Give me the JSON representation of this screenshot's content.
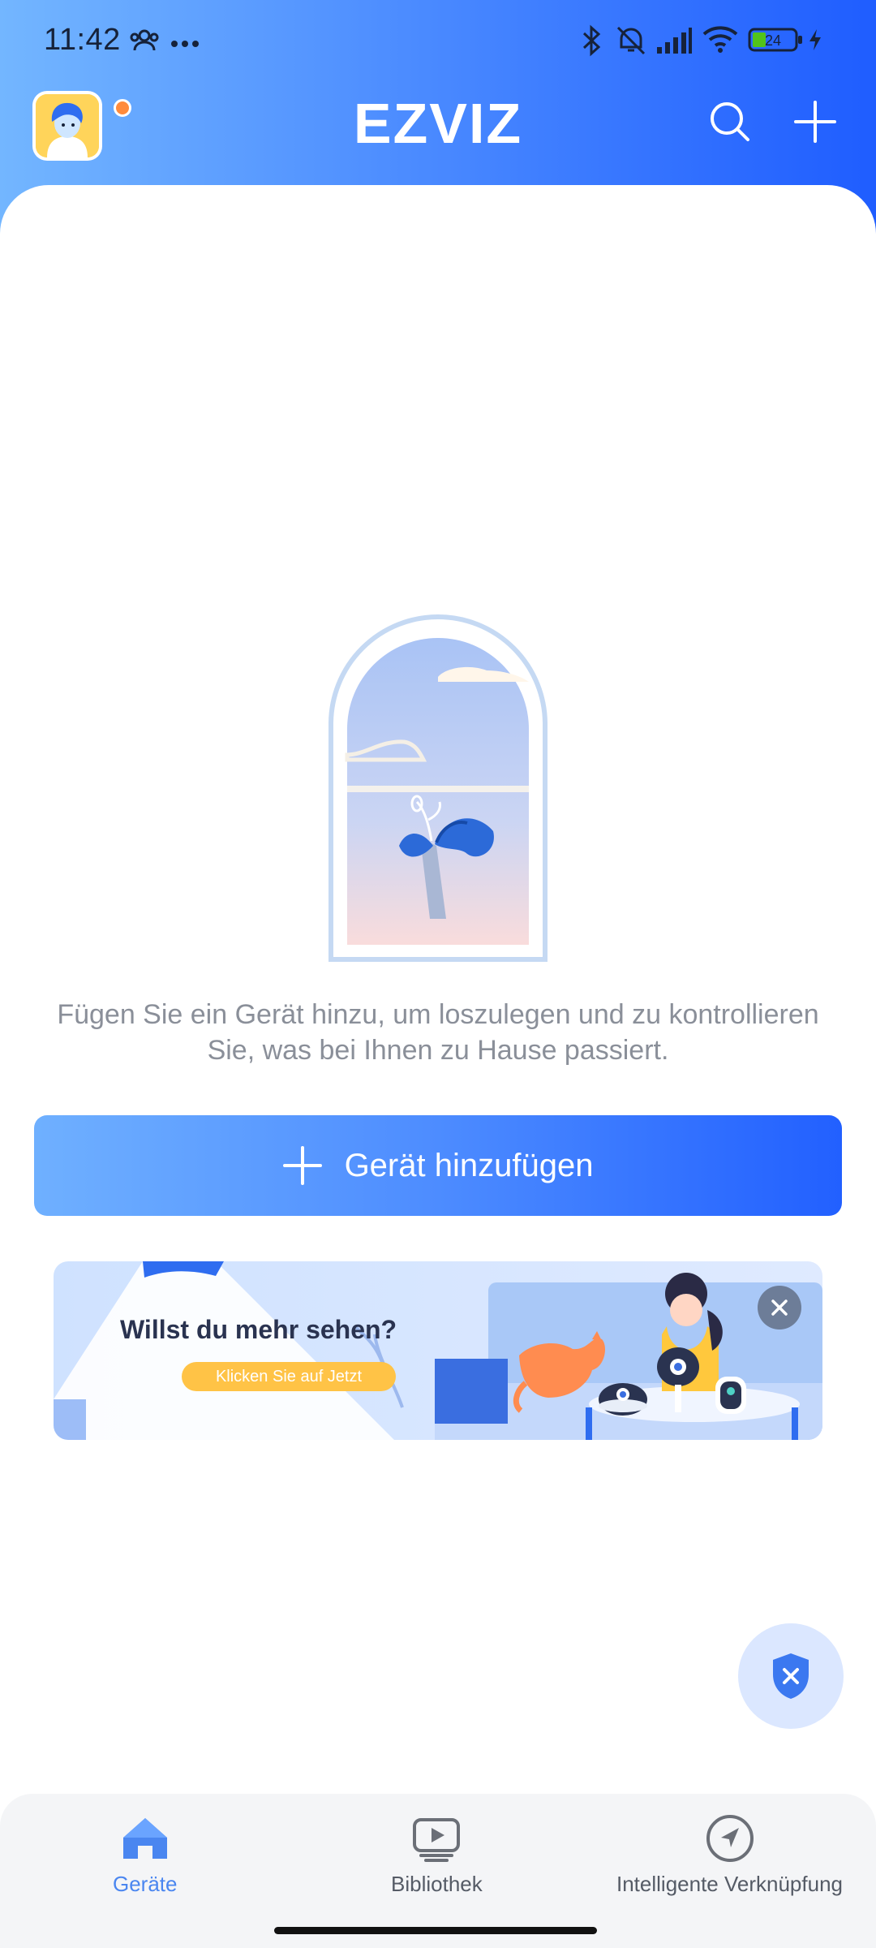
{
  "status_bar": {
    "time": "11:42",
    "battery": "24",
    "icons": [
      "people-icon",
      "more-dots-icon",
      "bluetooth-icon",
      "mute-icon",
      "signal-icon",
      "wifi-icon",
      "battery-icon",
      "charging-icon"
    ]
  },
  "header": {
    "logo_text": "EZVIZ",
    "icons": [
      "avatar",
      "search-icon",
      "plus-icon"
    ]
  },
  "empty_state": {
    "message": "Fügen Sie ein Gerät hinzu, um loszulegen und zu kontrollieren Sie, was bei Ihnen zu Hause passiert."
  },
  "add_device": {
    "label": "Gerät hinzufügen"
  },
  "promo": {
    "title": "Willst du mehr sehen?",
    "cta": "Klicken Sie auf Jetzt"
  },
  "bottom_nav": {
    "items": [
      {
        "label": "Geräte",
        "icon": "home-icon",
        "active": true
      },
      {
        "label": "Bibliothek",
        "icon": "library-icon",
        "active": false
      },
      {
        "label": "Intelligente Verknüpfung",
        "icon": "navigation-icon",
        "active": false
      }
    ]
  },
  "colors": {
    "accent": "#1f5dff",
    "accent_light": "#73b6ff",
    "nav_active": "#4a86f0",
    "promo_cta": "#ffc346"
  }
}
